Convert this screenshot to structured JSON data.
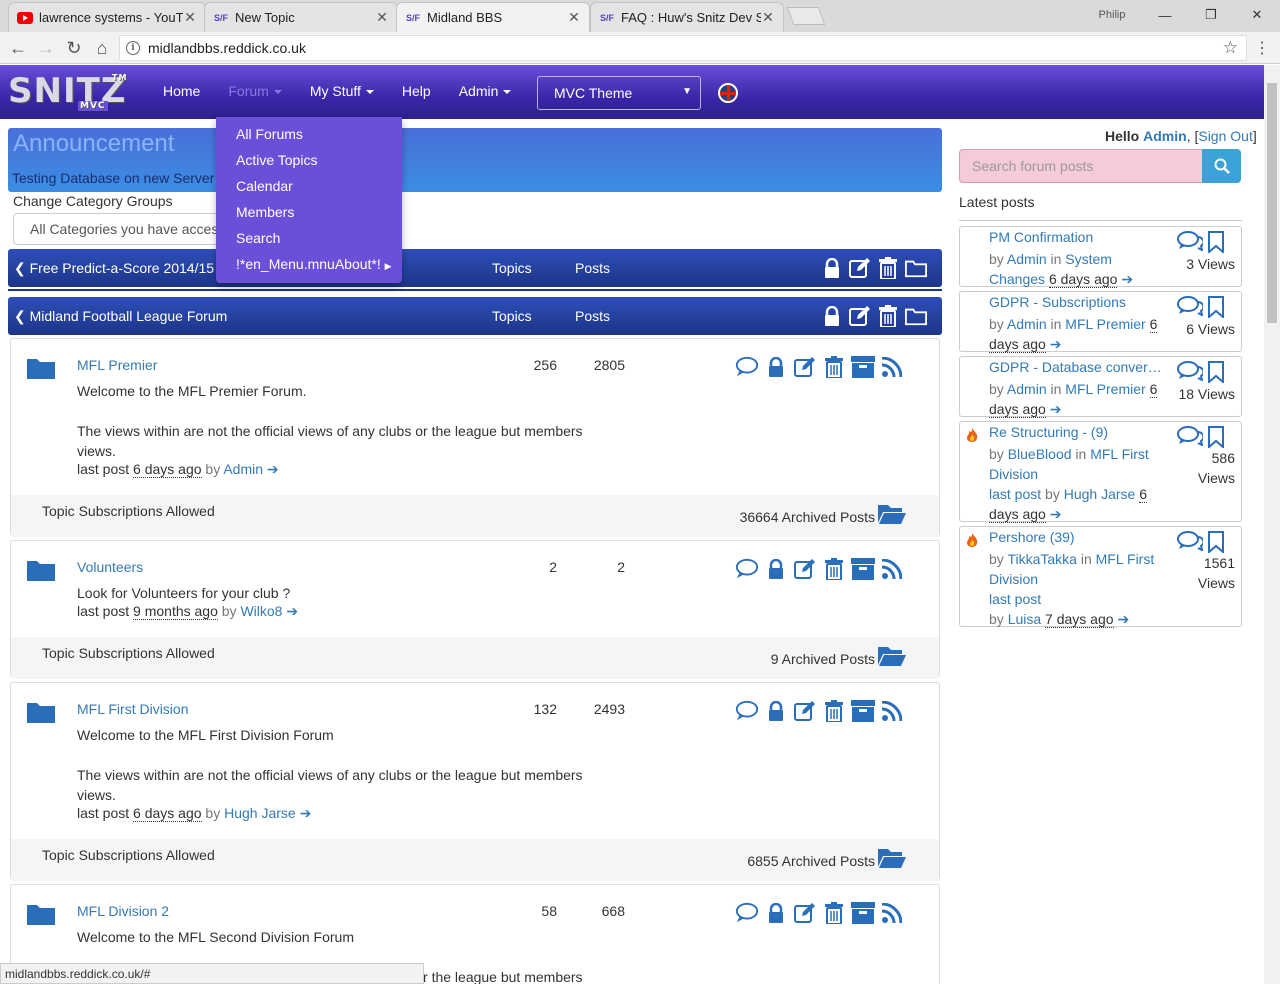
{
  "browser": {
    "tabs": [
      {
        "title": "lawrence systems - YouTube",
        "favicon": "youtube-icon"
      },
      {
        "title": "New Topic",
        "favicon": "snitz-icon"
      },
      {
        "title": "Midland BBS",
        "favicon": "snitz-icon"
      },
      {
        "title": "FAQ : Huw's Snitz Dev Site",
        "favicon": "snitz-icon"
      }
    ],
    "profile": "Philip",
    "url": "midlandbbs.reddick.co.uk",
    "status_url": "midlandbbs.reddick.co.uk/#"
  },
  "nav": {
    "logo": "SNITZ",
    "logo_sub": "MVC",
    "logo_tm": "TM",
    "home": "Home",
    "forum": "Forum",
    "mystuff": "My Stuff",
    "help": "Help",
    "admin": "Admin",
    "theme": "MVC Theme"
  },
  "forum_menu": [
    "All Forums",
    "Active Topics",
    "Calendar",
    "Members",
    "Search",
    "!*en_Menu.mnuAbout*!"
  ],
  "announcement": {
    "heading": "Announcement",
    "text": "Testing Database on new Server"
  },
  "category_groups": {
    "label": "Change Category Groups",
    "selected": "All Categories you have access to"
  },
  "categories": [
    {
      "name": "Free Predict-a-Score 2014/15",
      "topics_label": "Topics",
      "posts_label": "Posts"
    },
    {
      "name": "Midland Football League Forum",
      "topics_label": "Topics",
      "posts_label": "Posts"
    }
  ],
  "forums": [
    {
      "name": "MFL Premier",
      "topics": "256",
      "posts": "2805",
      "desc1": "Welcome to the MFL Premier Forum.",
      "desc2": "The views within are not the official views of any clubs or the league but members views.",
      "lastpost_label": "last post",
      "ago": "6 days ago",
      "by": "by",
      "author": "Admin",
      "subs": "Topic Subscriptions Allowed",
      "archived": "36664 Archived Posts"
    },
    {
      "name": "Volunteers",
      "topics": "2",
      "posts": "2",
      "desc1": "Look for Volunteers for your club ?",
      "desc2": "",
      "lastpost_label": "last post",
      "ago": "9 months ago",
      "by": "by",
      "author": "Wilko8",
      "subs": "Topic Subscriptions Allowed",
      "archived": "9 Archived Posts"
    },
    {
      "name": "MFL First Division",
      "topics": "132",
      "posts": "2493",
      "desc1": "Welcome to the MFL First Division Forum",
      "desc2": "The views within are not the official views of any clubs or the league but members views.",
      "lastpost_label": "last post",
      "ago": "6 days ago",
      "by": "by",
      "author": "Hugh Jarse",
      "subs": "Topic Subscriptions Allowed",
      "archived": "6855 Archived Posts"
    },
    {
      "name": "MFL Division 2",
      "topics": "58",
      "posts": "668",
      "desc1": "Welcome to the MFL Second Division Forum",
      "desc2": "The views within are not the official views of any clubs or the league but members"
    }
  ],
  "sidebar": {
    "hello": "Hello",
    "user": "Admin",
    "signout": "Sign Out",
    "search_placeholder": "Search forum posts",
    "latest_label": "Latest posts",
    "posts": [
      {
        "title": "PM Confirmation",
        "by": "by",
        "author": "Admin",
        "in": "in",
        "forum": "System Changes",
        "ago": "6 days ago",
        "views_n": "3",
        "views_l": "Views",
        "hot": false
      },
      {
        "title": "GDPR - Subscriptions",
        "by": "by",
        "author": "Admin",
        "in": "in",
        "forum": "MFL Premier",
        "ago": "6 days ago",
        "views_n": "6",
        "views_l": "Views",
        "hot": false
      },
      {
        "title": "GDPR - Database conversion",
        "by": "by",
        "author": "Admin",
        "in": "in",
        "forum": "MFL Premier",
        "ago": "6 days ago",
        "views_n": "18",
        "views_l": "Views",
        "hot": false
      },
      {
        "title": "Re Structuring - (9)",
        "by": "by",
        "author": "BlueBlood",
        "in": "in",
        "forum": "MFL First Division",
        "lastpost": "last post",
        "by2": "by",
        "author2": "Hugh Jarse",
        "ago": "6 days ago",
        "views_n": "586",
        "views_l": "Views",
        "hot": true
      },
      {
        "title": "Pershore (39)",
        "by": "by",
        "author": "TikkaTakka",
        "in": "in",
        "forum": "MFL First Division",
        "lastpost": "last post",
        "by2": "by",
        "author2": "Luisa",
        "ago": "7 days ago",
        "views_n": "1561",
        "views_l": "Views",
        "hot": true
      }
    ]
  },
  "colors": {
    "navbar": "#3a26a8",
    "dropdown": "#6a4fd8",
    "category": "#1d3588",
    "icon": "#2a6db8",
    "search_button": "#3aa3d8"
  }
}
